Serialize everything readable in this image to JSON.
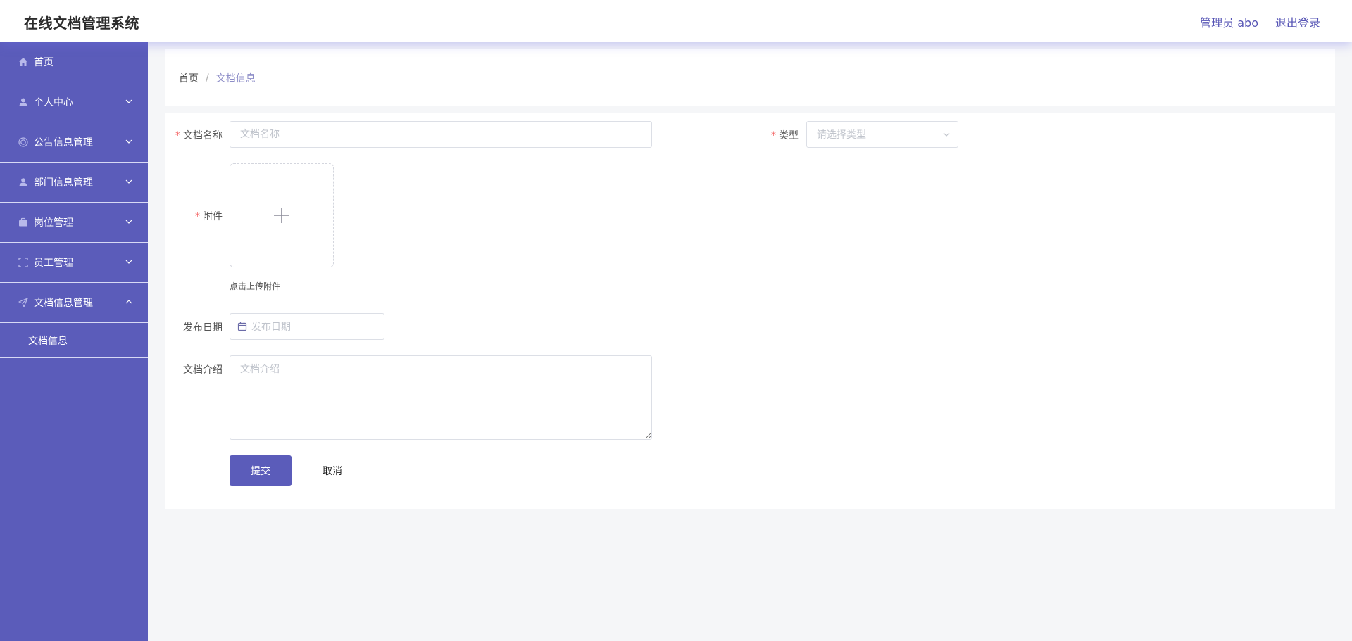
{
  "header": {
    "app_title": "在线文档管理系统",
    "user_label": "管理员 abo",
    "logout_label": "退出登录"
  },
  "sidebar": {
    "items": [
      {
        "label": "首页",
        "icon": "home-icon",
        "expandable": false
      },
      {
        "label": "个人中心",
        "icon": "user-icon",
        "expandable": true
      },
      {
        "label": "公告信息管理",
        "icon": "notice-icon",
        "expandable": true
      },
      {
        "label": "部门信息管理",
        "icon": "department-icon",
        "expandable": true
      },
      {
        "label": "岗位管理",
        "icon": "briefcase-icon",
        "expandable": true
      },
      {
        "label": "员工管理",
        "icon": "scan-icon",
        "expandable": true
      },
      {
        "label": "文档信息管理",
        "icon": "send-icon",
        "expandable": true,
        "expanded": true
      }
    ],
    "submenu": [
      {
        "label": "文档信息"
      }
    ]
  },
  "breadcrumb": {
    "home": "首页",
    "separator": "/",
    "current": "文档信息"
  },
  "form": {
    "doc_name": {
      "label": "文档名称",
      "placeholder": "文档名称",
      "value": "",
      "required": true
    },
    "type": {
      "label": "类型",
      "placeholder": "请选择类型",
      "required": true
    },
    "attachment": {
      "label": "附件",
      "hint": "点击上传附件",
      "required": true
    },
    "publish_date": {
      "label": "发布日期",
      "placeholder": "发布日期"
    },
    "intro": {
      "label": "文档介绍",
      "placeholder": "文档介绍",
      "value": ""
    },
    "submit_label": "提交",
    "cancel_label": "取消"
  },
  "colors": {
    "primary": "#5b5cba",
    "sidebar_bg": "#5b5cba",
    "required": "#f56c6c",
    "page_bg": "#f5f6f8"
  }
}
